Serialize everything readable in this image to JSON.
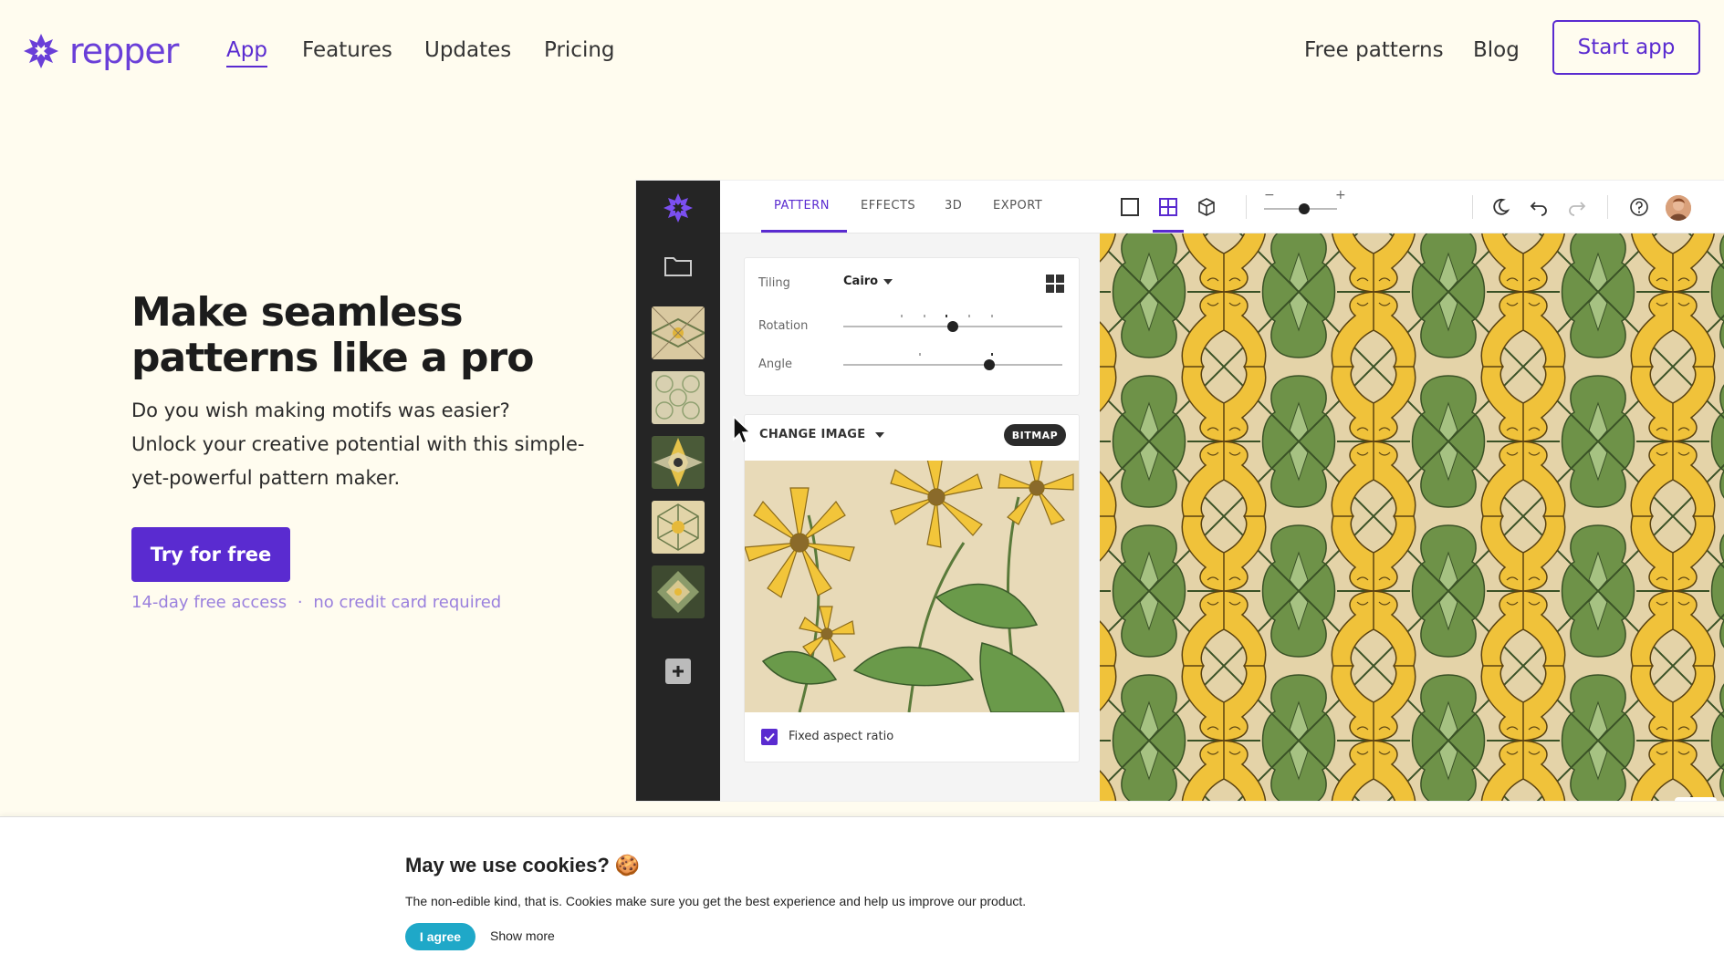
{
  "brand": {
    "name": "repper",
    "accent": "#5a2bd0"
  },
  "nav": {
    "items": [
      {
        "label": "App",
        "active": true
      },
      {
        "label": "Features"
      },
      {
        "label": "Updates"
      },
      {
        "label": "Pricing"
      }
    ],
    "right": [
      {
        "label": "Free patterns"
      },
      {
        "label": "Blog"
      }
    ],
    "cta": "Start app"
  },
  "hero": {
    "title_line1": "Make seamless",
    "title_line2": "patterns like a pro",
    "sub_line1": "Do you wish making motifs was easier?",
    "sub_line2": "Unlock your creative potential with this simple-",
    "sub_line3": "yet-powerful pattern maker.",
    "cta": "Try for free",
    "note_a": "14-day free access",
    "note_sep": "·",
    "note_b": "no credit card required"
  },
  "app": {
    "tabs": [
      "PATTERN",
      "EFFECTS",
      "3D",
      "EXPORT"
    ],
    "active_tab": "PATTERN",
    "tiling_label": "Tiling",
    "tiling_value": "Cairo",
    "rotation_label": "Rotation",
    "angle_label": "Angle",
    "change_image": "CHANGE IMAGE",
    "image_type": "BITMAP",
    "fixed_aspect_label": "Fixed aspect ratio",
    "fixed_aspect_checked": true,
    "zoom_minus": "−",
    "zoom_plus": "+"
  },
  "cookie": {
    "title": "May we use cookies? 🍪",
    "text": "The non-edible kind, that is. Cookies make sure you get the best experience and help us improve our product.",
    "agree": "I agree",
    "more": "Show more"
  }
}
